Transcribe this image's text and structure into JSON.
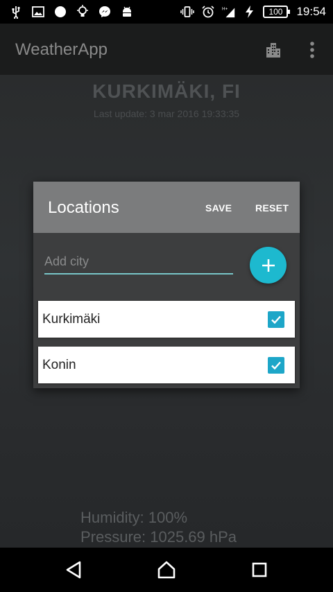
{
  "status_bar": {
    "time": "19:54",
    "battery": "100",
    "left_icons": [
      "usb-icon",
      "image-icon",
      "record-icon",
      "lightbulb-icon",
      "messenger-icon",
      "android-icon"
    ],
    "right_icons": [
      "vibrate-icon",
      "alarm-icon",
      "signal-icon",
      "charging-icon"
    ],
    "network_type": "H+"
  },
  "app_bar": {
    "title": "WeatherApp",
    "actions": [
      "city-icon",
      "more-vert-icon"
    ]
  },
  "weather": {
    "city": "KURKIMÄKI, FI",
    "last_update": "Last update: 3 mar 2016 19:33:35",
    "humidity": "Humidity: 100%",
    "pressure": "Pressure: 1025.69 hPa"
  },
  "dialog": {
    "title": "Locations",
    "save_label": "SAVE",
    "reset_label": "RESET",
    "add_city_placeholder": "Add city",
    "add_city_value": "",
    "locations": [
      {
        "name": "Kurkimäki",
        "checked": true
      },
      {
        "name": "Konin",
        "checked": true
      }
    ]
  },
  "colors": {
    "accent": "#1db9cf",
    "checkbox": "#1da6c8",
    "dialog_header": "#7b7c7d",
    "dialog_body": "#3d3e3f"
  }
}
